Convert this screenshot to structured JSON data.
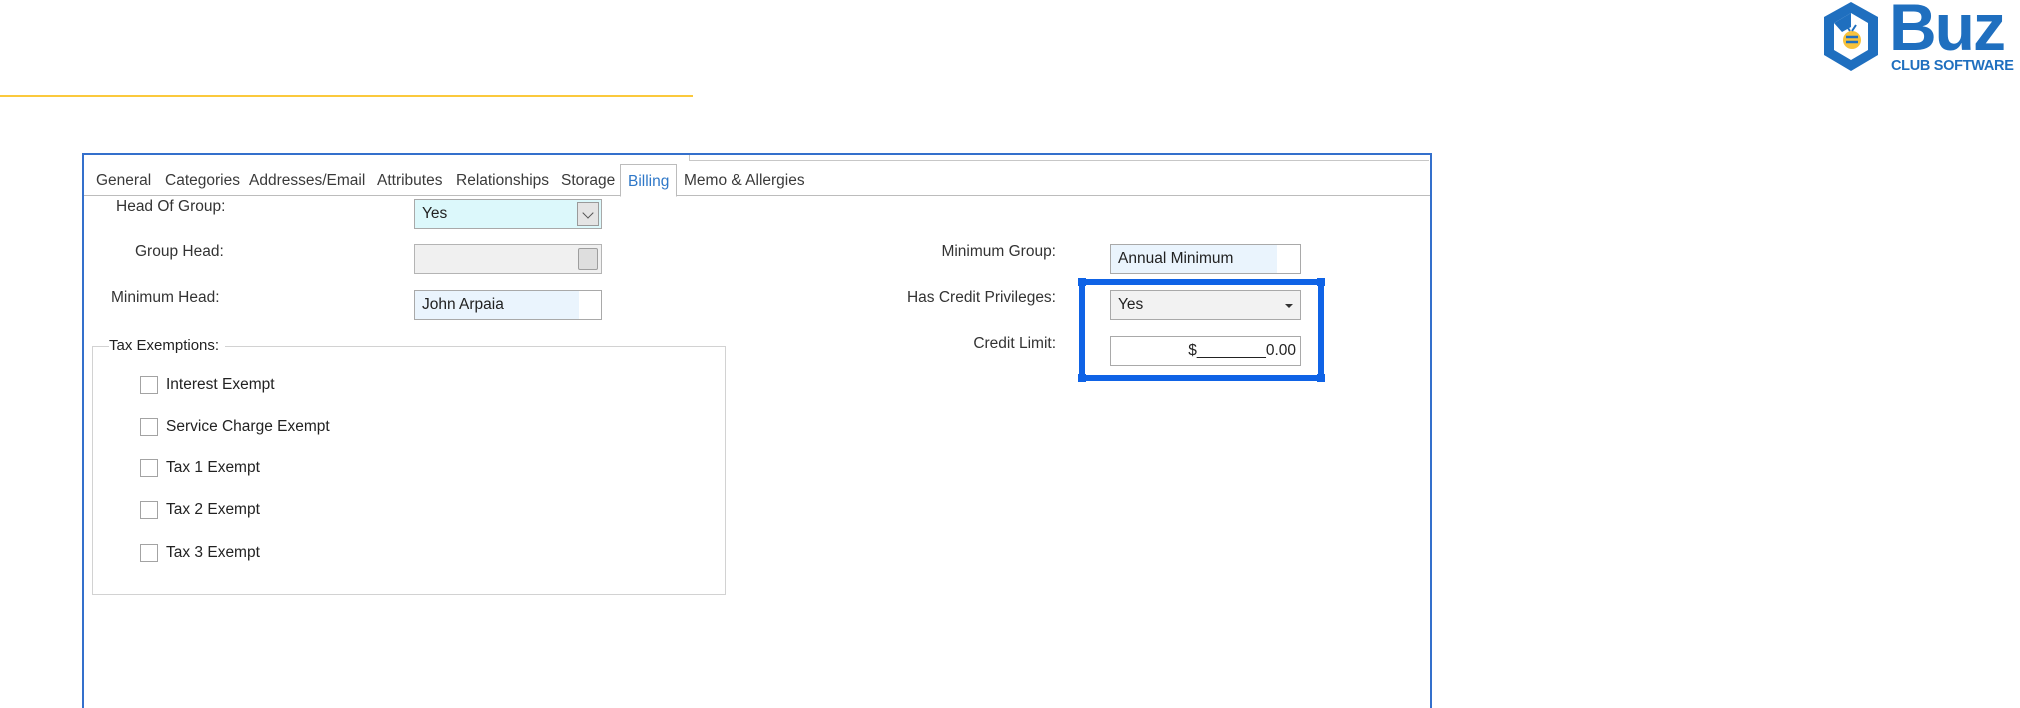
{
  "brand": {
    "logo_text": "Buz",
    "logo_subtitle": "CLUB SOFTWARE",
    "logo_color": "#1f6fbf",
    "accent_line_color": "#fbc93c"
  },
  "tabs": [
    {
      "label": "General",
      "active": false
    },
    {
      "label": "Categories",
      "active": false
    },
    {
      "label": "Addresses/Email",
      "active": false
    },
    {
      "label": "Attributes",
      "active": false
    },
    {
      "label": "Relationships",
      "active": false
    },
    {
      "label": "Storage",
      "active": false
    },
    {
      "label": "Billing",
      "active": true
    },
    {
      "label": "Memo & Allergies",
      "active": false
    }
  ],
  "billing": {
    "head_of_group": {
      "label": "Head Of Group:",
      "value": "Yes"
    },
    "group_head": {
      "label": "Group Head:",
      "value": ""
    },
    "minimum_head": {
      "label": "Minimum Head:",
      "value": "John Arpaia"
    },
    "minimum_group": {
      "label": "Minimum Group:",
      "value": "Annual Minimum"
    },
    "has_credit_privileges": {
      "label": "Has Credit Privileges:",
      "value": "Yes"
    },
    "credit_limit": {
      "label": "Credit Limit:",
      "value": "$________0.00"
    }
  },
  "tax_exemptions": {
    "title": "Tax Exemptions:",
    "items": [
      {
        "label": "Interest Exempt",
        "checked": false
      },
      {
        "label": "Service Charge Exempt",
        "checked": false
      },
      {
        "label": "Tax 1 Exempt",
        "checked": false
      },
      {
        "label": "Tax 2 Exempt",
        "checked": false
      },
      {
        "label": "Tax 3 Exempt",
        "checked": false
      }
    ]
  },
  "colors": {
    "window_border": "#3470cc",
    "active_tab_text": "#2f78c8",
    "highlight_box": "#0f63e6",
    "combo_fill": "#dcf8fb"
  }
}
